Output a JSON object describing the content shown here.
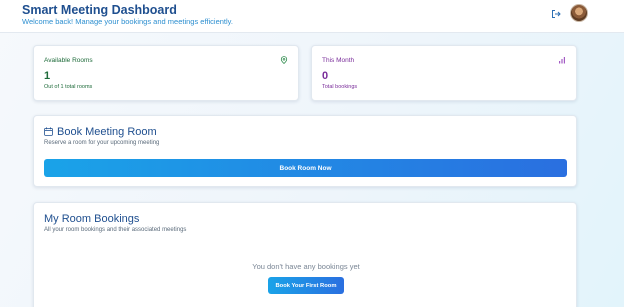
{
  "header": {
    "title": "Smart Meeting Dashboard",
    "subtitle": "Welcome back! Manage your bookings and meetings efficiently.",
    "logout_icon": "logout-icon",
    "avatar_icon": "user-avatar"
  },
  "stats": [
    {
      "label": "Available Rooms",
      "value": "1",
      "note": "Out of 1 total rooms",
      "icon": "location-pin-icon",
      "color": "#1e6b3a"
    },
    {
      "label": "This Month",
      "value": "0",
      "note": "Total bookings",
      "icon": "bar-chart-icon",
      "color": "#7a2d9a"
    }
  ],
  "book_section": {
    "title": "Book Meeting Room",
    "description": "Reserve a room for your upcoming meeting",
    "button_label": "Book Room Now",
    "icon": "calendar-icon"
  },
  "bookings_section": {
    "title": "My Room Bookings",
    "description": "All your room bookings and their associated meetings",
    "empty_text": "You don't have any bookings yet",
    "button_label": "Book Your First Room"
  },
  "colors": {
    "accent_start": "#1aa3e8",
    "accent_end": "#2a6fe0",
    "title_blue": "#1f4f8f"
  }
}
